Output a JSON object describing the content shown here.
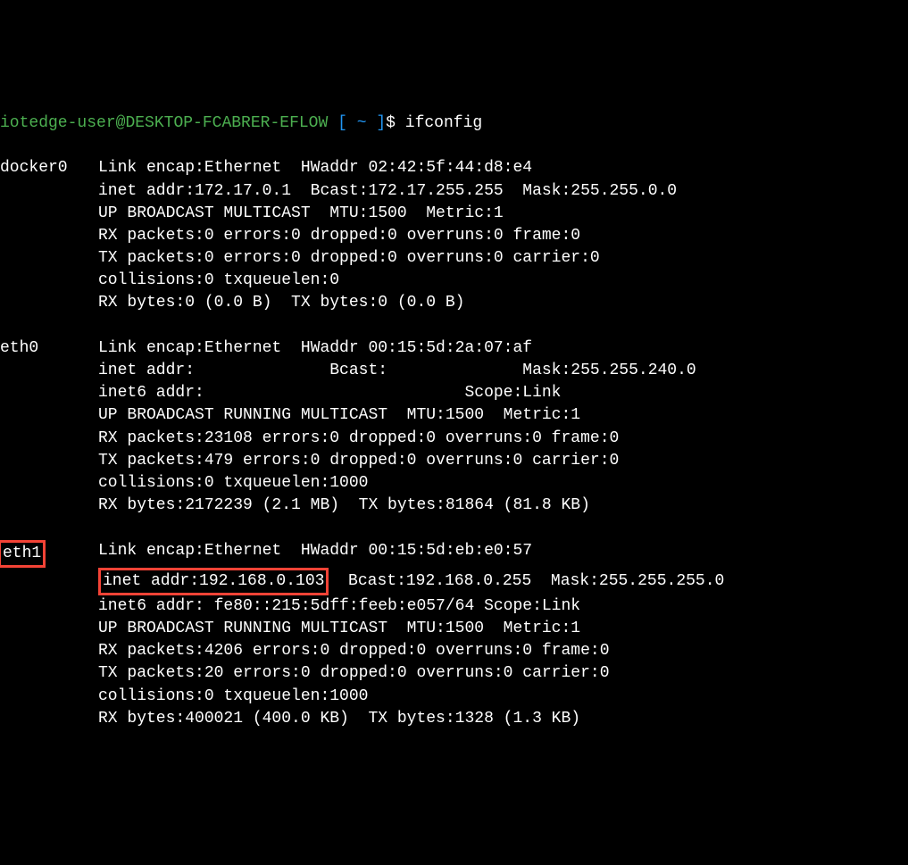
{
  "prompt": {
    "user": "iotedge-user",
    "host": "DESKTOP-FCABRER-EFLOW",
    "path": "~",
    "symbol": "$"
  },
  "command": "ifconfig",
  "interfaces": [
    {
      "name": "docker0",
      "lines": [
        "Link encap:Ethernet  HWaddr 02:42:5f:44:d8:e4",
        "inet addr:172.17.0.1  Bcast:172.17.255.255  Mask:255.255.0.0",
        "UP BROADCAST MULTICAST  MTU:1500  Metric:1",
        "RX packets:0 errors:0 dropped:0 overruns:0 frame:0",
        "TX packets:0 errors:0 dropped:0 overruns:0 carrier:0",
        "collisions:0 txqueuelen:0",
        "RX bytes:0 (0.0 B)  TX bytes:0 (0.0 B)"
      ]
    },
    {
      "name": "eth0",
      "lines": [
        "Link encap:Ethernet  HWaddr 00:15:5d:2a:07:af",
        "inet addr:              Bcast:              Mask:255.255.240.0",
        "inet6 addr:                           Scope:Link",
        "UP BROADCAST RUNNING MULTICAST  MTU:1500  Metric:1",
        "RX packets:23108 errors:0 dropped:0 overruns:0 frame:0",
        "TX packets:479 errors:0 dropped:0 overruns:0 carrier:0",
        "collisions:0 txqueuelen:1000",
        "RX bytes:2172239 (2.1 MB)  TX bytes:81864 (81.8 KB)"
      ]
    },
    {
      "name": "eth1",
      "highlightName": true,
      "lines": [
        "Link encap:Ethernet  HWaddr 00:15:5d:eb:e0:57",
        {
          "highlight": "inet addr:192.168.0.103",
          "rest": "  Bcast:192.168.0.255  Mask:255.255.255.0"
        },
        "inet6 addr: fe80::215:5dff:feeb:e057/64 Scope:Link",
        "UP BROADCAST RUNNING MULTICAST  MTU:1500  Metric:1",
        "RX packets:4206 errors:0 dropped:0 overruns:0 frame:0",
        "TX packets:20 errors:0 dropped:0 overruns:0 carrier:0",
        "collisions:0 txqueuelen:1000",
        "RX bytes:400021 (400.0 KB)  TX bytes:1328 (1.3 KB)"
      ]
    }
  ]
}
